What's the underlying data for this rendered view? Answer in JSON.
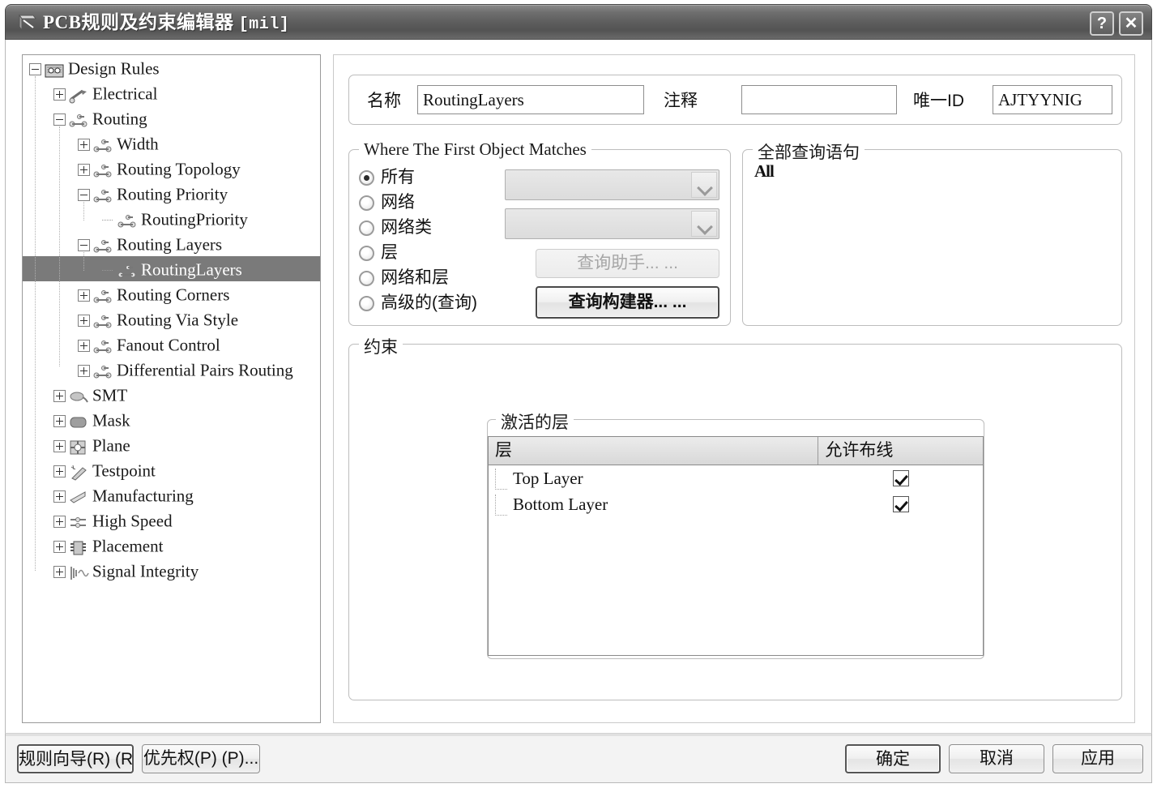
{
  "window": {
    "title": "PCB规则及约束编辑器",
    "unit": "[mil]",
    "help_button": "?",
    "close_button": "✕"
  },
  "tree": {
    "nodes": [
      {
        "label": "Design Rules",
        "depth": 0,
        "state": "expanded",
        "icon": "design-rules-icon",
        "selected": false
      },
      {
        "label": "Electrical",
        "depth": 1,
        "state": "collapsed",
        "icon": "electrical-icon",
        "selected": false
      },
      {
        "label": "Routing",
        "depth": 1,
        "state": "expanded",
        "icon": "routing-icon",
        "selected": false
      },
      {
        "label": "Width",
        "depth": 2,
        "state": "collapsed",
        "icon": "routing-icon",
        "selected": false
      },
      {
        "label": "Routing Topology",
        "depth": 2,
        "state": "collapsed",
        "icon": "routing-icon",
        "selected": false
      },
      {
        "label": "Routing Priority",
        "depth": 2,
        "state": "expanded",
        "icon": "routing-icon",
        "selected": false
      },
      {
        "label": "RoutingPriority",
        "depth": 3,
        "state": "leaf",
        "icon": "routing-icon",
        "selected": false
      },
      {
        "label": "Routing Layers",
        "depth": 2,
        "state": "expanded",
        "icon": "routing-icon",
        "selected": false
      },
      {
        "label": "RoutingLayers",
        "depth": 3,
        "state": "leaf",
        "icon": "routing-icon",
        "selected": true
      },
      {
        "label": "Routing Corners",
        "depth": 2,
        "state": "collapsed",
        "icon": "routing-icon",
        "selected": false
      },
      {
        "label": "Routing Via Style",
        "depth": 2,
        "state": "collapsed",
        "icon": "routing-icon",
        "selected": false
      },
      {
        "label": "Fanout Control",
        "depth": 2,
        "state": "collapsed",
        "icon": "routing-icon",
        "selected": false
      },
      {
        "label": "Differential Pairs Routing",
        "depth": 2,
        "state": "collapsed",
        "icon": "routing-icon",
        "selected": false
      },
      {
        "label": "SMT",
        "depth": 1,
        "state": "collapsed",
        "icon": "smt-icon",
        "selected": false
      },
      {
        "label": "Mask",
        "depth": 1,
        "state": "collapsed",
        "icon": "mask-icon",
        "selected": false
      },
      {
        "label": "Plane",
        "depth": 1,
        "state": "collapsed",
        "icon": "plane-icon",
        "selected": false
      },
      {
        "label": "Testpoint",
        "depth": 1,
        "state": "collapsed",
        "icon": "testpoint-icon",
        "selected": false
      },
      {
        "label": "Manufacturing",
        "depth": 1,
        "state": "collapsed",
        "icon": "manufacturing-icon",
        "selected": false
      },
      {
        "label": "High Speed",
        "depth": 1,
        "state": "collapsed",
        "icon": "high-speed-icon",
        "selected": false
      },
      {
        "label": "Placement",
        "depth": 1,
        "state": "collapsed",
        "icon": "placement-icon",
        "selected": false
      },
      {
        "label": "Signal Integrity",
        "depth": 1,
        "state": "collapsed",
        "icon": "signal-integrity-icon",
        "selected": false
      }
    ]
  },
  "header": {
    "name_label": "名称",
    "name_value": "RoutingLayers",
    "comment_label": "注释",
    "comment_value": "",
    "unique_id_label": "唯一ID",
    "unique_id_value": "AJTYYNIG"
  },
  "where_matches": {
    "legend": "Where The First Object Matches",
    "options": [
      {
        "label": "所有",
        "selected": true
      },
      {
        "label": "网络",
        "selected": false
      },
      {
        "label": "网络类",
        "selected": false
      },
      {
        "label": "层",
        "selected": false
      },
      {
        "label": "网络和层",
        "selected": false
      },
      {
        "label": "高级的(查询)",
        "selected": false
      }
    ],
    "net_combo_value": "",
    "netclass_combo_value": "",
    "query_helper_button": "查询助手... ...",
    "query_builder_button": "查询构建器... ..."
  },
  "query_statement": {
    "legend": "全部查询语句",
    "text": "All"
  },
  "constraints": {
    "legend": "约束",
    "active_layers_legend": "激活的层",
    "table": {
      "columns": [
        "层",
        "允许布线"
      ],
      "rows": [
        {
          "layer": "Top Layer",
          "allow_routing": true
        },
        {
          "layer": "Bottom Layer",
          "allow_routing": true
        }
      ]
    }
  },
  "footer": {
    "rule_wizard_button": "规则向导(R) (R)...",
    "priority_button": "优先权(P) (P)...",
    "ok_button": "确定",
    "cancel_button": "取消",
    "apply_button": "应用"
  }
}
